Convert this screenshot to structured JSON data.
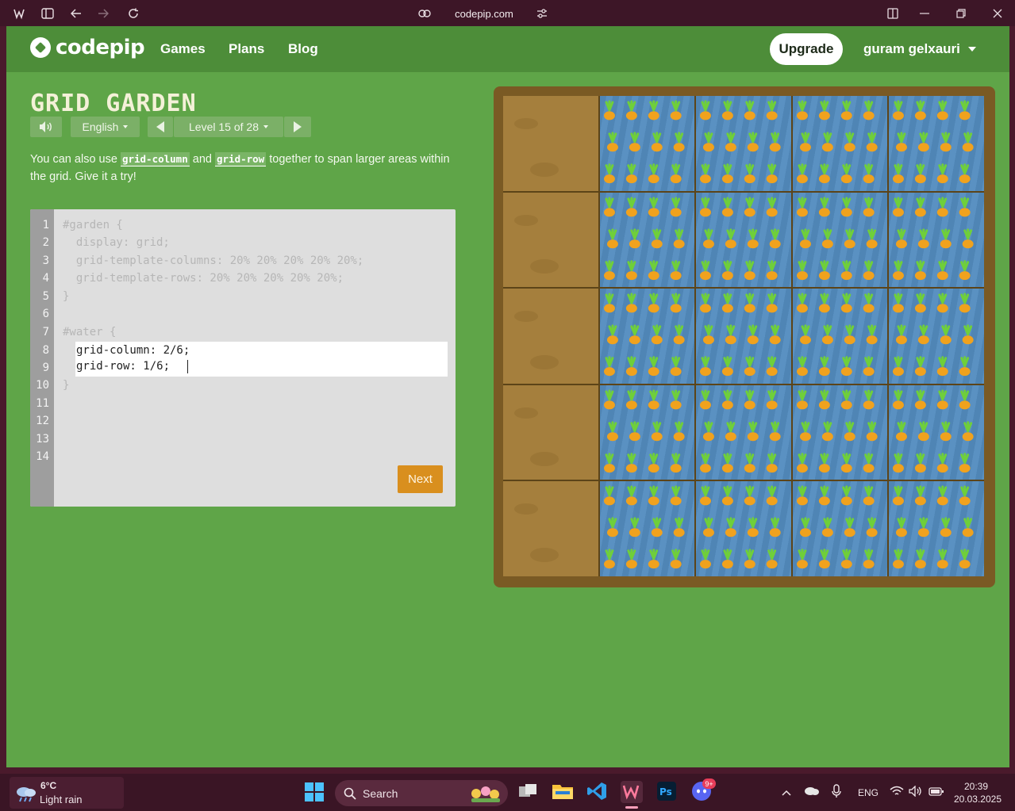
{
  "browser": {
    "url": "codepip.com"
  },
  "nav": {
    "logo_text": "codepip",
    "links": [
      "Games",
      "Plans",
      "Blog"
    ],
    "upgrade_label": "Upgrade",
    "user_name": "guram gelxauri"
  },
  "game": {
    "title": "GRID GARDEN",
    "language": "English",
    "level_label": "Level 15 of 28",
    "instructions": {
      "part1": "You can also use ",
      "code1": "grid-column",
      "part2": " and ",
      "code2": "grid-row",
      "part3": " together to span larger areas within the grid. Give it a try!"
    },
    "editor": {
      "line_numbers": [
        "1",
        "2",
        "3",
        "4",
        "5",
        "6",
        "7",
        "8",
        "9",
        "10",
        "11",
        "12",
        "13",
        "14"
      ],
      "lines": [
        "#garden {",
        "  display: grid;",
        "  grid-template-columns: 20% 20% 20% 20% 20%;",
        "  grid-template-rows: 20% 20% 20% 20% 20%;",
        "}",
        "",
        "#water {",
        "",
        "",
        "}"
      ],
      "input_lines": [
        "grid-column: 2/6;",
        "grid-row: 1/6;"
      ],
      "next_label": "Next"
    },
    "garden": {
      "columns": 5,
      "rows": 5,
      "water_column_span": "2/6",
      "water_row_span": "1/6",
      "colors": {
        "frame": "#7a5a24",
        "dirt": "#a57f3d",
        "water": "#4f85b5",
        "carrot": "#f0a21e",
        "leaf": "#6fcf3a"
      }
    }
  },
  "taskbar": {
    "weather_temp": "6°C",
    "weather_desc": "Light rain",
    "search_label": "Search",
    "language": "ENG",
    "time": "20:39",
    "date": "20.03.2025",
    "discord_badge": "9+"
  }
}
